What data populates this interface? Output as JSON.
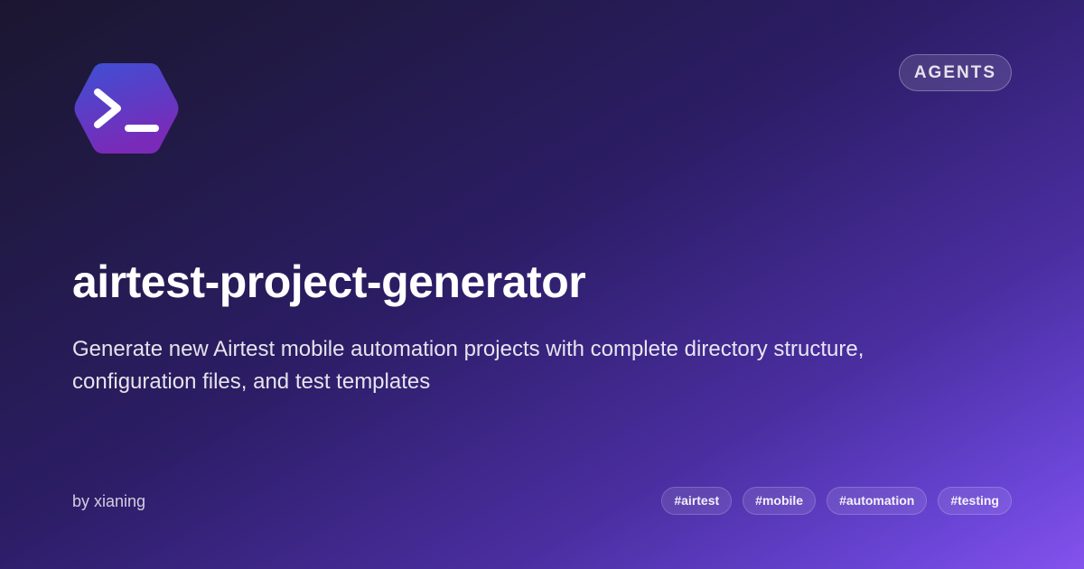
{
  "header": {
    "logo_icon": "terminal-prompt-icon",
    "badge_label": "AGENTS"
  },
  "main": {
    "title": "airtest-project-generator",
    "description": "Generate new Airtest mobile automation projects with complete directory structure, configuration files, and test templates"
  },
  "footer": {
    "author": "by xianing",
    "tags": [
      "#airtest",
      "#mobile",
      "#automation",
      "#testing"
    ]
  },
  "colors": {
    "background_start": "#1b1630",
    "background_end": "#8552ee",
    "logo_top": "#3d50d4",
    "logo_bottom": "#7a2ab8"
  }
}
